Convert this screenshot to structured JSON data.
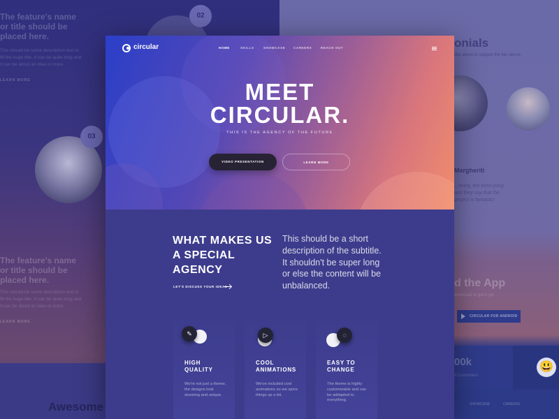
{
  "background_left": {
    "feature_title_top": "The feature's name or title should be placed here.",
    "feature_text_top": "This should be some description text to fill the huge title. It can be quite long and it can be about an idea or more.",
    "learn_more_top": "LEARN MORE",
    "badge_02": "02",
    "badge_03": "03",
    "feature_title_bottom": "The feature's name or title should be placed here.",
    "feature_text_bottom": "This should be some description text to fill the huge title. It can be quite long and it can be about an idea or more.",
    "learn_more_bottom": "LEARN MORE",
    "awesome": "Awesome"
  },
  "background_right": {
    "testimonials_title": "onials",
    "testimonials_sub": "title above to support the title above.",
    "person_name": "Margheriti",
    "quote": "...being, the best-using and they say that the project is fantastic!",
    "app_title": "d the App",
    "app_sub": "download to get it yet",
    "android_button": "CIRCULAR FOR ANDROID",
    "stat_value": "00k",
    "stat_label": "d Customers",
    "footer_item_1": "SHOWCASE",
    "footer_item_2": "CAREERS",
    "emoji": "😃"
  },
  "nav": {
    "logo_text": "circular",
    "items": [
      "HOME",
      "SKILLS",
      "SHOWCASE",
      "CAREERS",
      "REACH OUT"
    ]
  },
  "hero": {
    "title_line1": "MEET",
    "title_line2": "CIRCULAR.",
    "subtitle": "THIS IS THE AGENCY OF THE FUTURE",
    "primary_button": "VIDEO PRESENTATION",
    "secondary_button": "LEARN MORE"
  },
  "about": {
    "title": "WHAT MAKES US A SPECIAL AGENCY",
    "link": "LET'S DISCUSS YOUR IDEAS",
    "description": "This should be a short description of the subtitle. It shouldn't be super long or else the content will be unbalanced."
  },
  "features": [
    {
      "title_line1": "HIGH",
      "title_line2": "QUALITY",
      "description": "We're not just a theme, the designs look stunning and unique.",
      "icon": "brush-icon"
    },
    {
      "title_line1": "COOL",
      "title_line2": "ANIMATIONS",
      "description": "We've included cool animations so we spice things up a bit.",
      "icon": "play-icon"
    },
    {
      "title_line1": "EASY TO",
      "title_line2": "CHANGE",
      "description": "The theme is highly customizable and can be addapted to everything.",
      "icon": "dotted-circle-icon"
    }
  ],
  "colors": {
    "hero_gradient_start": "#2b3fc8",
    "hero_gradient_end": "#f08d6c",
    "body_bg": "#3d3c8c",
    "dark_button": "#272334"
  }
}
